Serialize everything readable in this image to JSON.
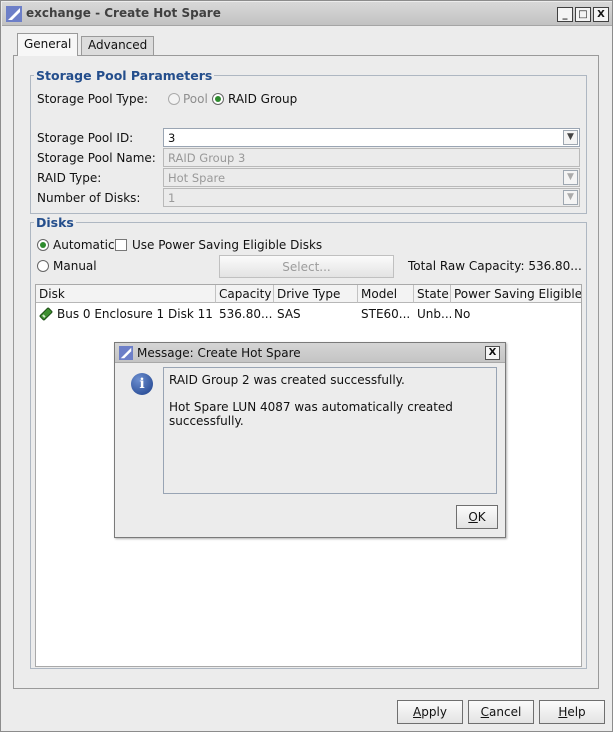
{
  "window": {
    "title": "exchange - Create Hot Spare",
    "min_label": "_",
    "max_label": "□",
    "close_label": "X"
  },
  "tabs": [
    "General",
    "Advanced"
  ],
  "storage_pool": {
    "legend": "Storage Pool Parameters",
    "type_label": "Storage Pool Type:",
    "type_option_pool": "Pool",
    "type_option_raid": "RAID Group",
    "selected_type": "RAID Group",
    "id_label": "Storage Pool ID:",
    "id_value": "3",
    "name_label": "Storage Pool Name:",
    "name_value": "RAID Group 3",
    "raid_type_label": "RAID Type:",
    "raid_type_value": "Hot Spare",
    "num_disks_label": "Number of Disks:",
    "num_disks_value": "1"
  },
  "disks": {
    "legend": "Disks",
    "automatic_label": "Automatic",
    "power_saving_label": "Use Power Saving Eligible Disks",
    "manual_label": "Manual",
    "select_button": "Select...",
    "total_raw_capacity": "Total Raw Capacity: 536.80...",
    "columns": [
      "Disk",
      "Capacity",
      "Drive Type",
      "Model",
      "State",
      "Power Saving Eligible"
    ],
    "rows": [
      [
        "Bus 0 Enclosure 1 Disk 11",
        "536.80...",
        "SAS",
        "STE60...",
        "Unb...",
        "No"
      ]
    ]
  },
  "dialog": {
    "title": "Message: Create Hot Spare",
    "line1": "RAID Group 2 was created successfully.",
    "line2": "Hot Spare LUN 4087 was automatically created",
    "line3": "successfully.",
    "ok_button": "OK",
    "close_label": "X",
    "icon_glyph": "i"
  },
  "footer": {
    "apply": "Apply",
    "cancel": "Cancel",
    "help": "Help"
  },
  "colors": {
    "legend": "#244e8c",
    "radio_selected": "#2e8b2e",
    "info_icon": "#1b3f8a"
  }
}
